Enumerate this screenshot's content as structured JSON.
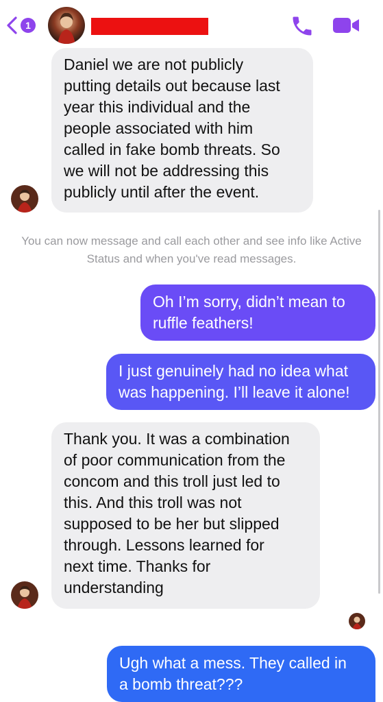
{
  "header": {
    "back_badge_count": "1",
    "accent_color": "#8e44ec",
    "redaction_color": "#ec1111",
    "icons": {
      "back": "chevron-left-icon",
      "call": "phone-icon",
      "video": "video-camera-icon"
    }
  },
  "messages": [
    {
      "direction": "incoming",
      "text": "Daniel we are not publicly\nputting details out because last\nyear this individual and the\npeople associated with him\ncalled in fake bomb threats. So\nwe will not be addressing this\npublicly until after the event."
    },
    {
      "direction": "system",
      "text": "You can now message and call each other and see info\nlike Active Status and when you've read messages."
    },
    {
      "direction": "outgoing",
      "text": "Oh I’m sorry, didn’t mean to\nruffle feathers!"
    },
    {
      "direction": "outgoing",
      "text": "I just genuinely had no idea what\nwas happening. I’ll leave it alone!"
    },
    {
      "direction": "incoming",
      "text": "Thank you.  It was a combination\nof poor communication from the\nconcom and this troll just led to\nthis. And this troll was not\nsupposed to be her but slipped\nthrough.   Lessons learned for\nnext time.  Thanks for\nunderstanding"
    },
    {
      "direction": "outgoing",
      "text": "Ugh what a mess. They called in\na bomb threat???"
    }
  ],
  "colors": {
    "incoming_bubble": "#eeeef0",
    "outgoing_bubble_top": "#6b4cf6",
    "outgoing_bubble_bottom": "#2f6af5",
    "system_text": "#9a9a9e"
  }
}
